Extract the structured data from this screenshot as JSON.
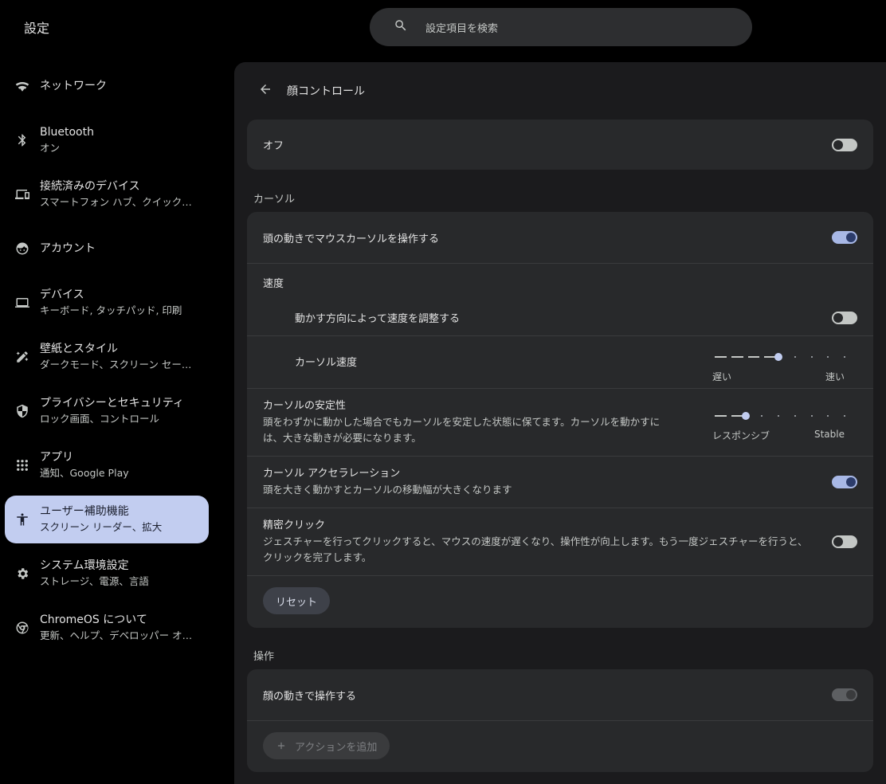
{
  "app": {
    "title": "設定"
  },
  "search": {
    "placeholder": "設定項目を検索"
  },
  "sidebar": {
    "items": [
      {
        "label": "ネットワーク",
        "sub": "",
        "icon": "wifi-icon"
      },
      {
        "label": "Bluetooth",
        "sub": "オン",
        "icon": "bluetooth-icon"
      },
      {
        "label": "接続済みのデバイス",
        "sub": "スマートフォン ハブ、クイック…",
        "icon": "connected-devices-icon"
      },
      {
        "label": "アカウント",
        "sub": "",
        "icon": "account-icon"
      },
      {
        "label": "デバイス",
        "sub": "キーボード, タッチパッド, 印刷",
        "icon": "laptop-icon"
      },
      {
        "label": "壁紙とスタイル",
        "sub": "ダークモード、スクリーン セー…",
        "icon": "palette-icon"
      },
      {
        "label": "プライバシーとセキュリティ",
        "sub": "ロック画面、コントロール",
        "icon": "shield-icon"
      },
      {
        "label": "アプリ",
        "sub": "通知、Google Play",
        "icon": "apps-grid-icon"
      },
      {
        "label": "ユーザー補助機能",
        "sub": "スクリーン リーダー、拡大",
        "icon": "accessibility-icon"
      },
      {
        "label": "システム環境設定",
        "sub": "ストレージ、電源、言語",
        "icon": "gear-icon"
      },
      {
        "label": "ChromeOS について",
        "sub": "更新、ヘルプ、デベロッパー オ…",
        "icon": "chrome-icon"
      }
    ],
    "active_index": 8,
    "active_color": "#c2cdf0"
  },
  "page": {
    "title": "顔コントロール"
  },
  "master": {
    "label": "オフ",
    "enabled": false
  },
  "cursor_section": {
    "title": "カーソル",
    "control_with_head": {
      "label": "頭の動きでマウスカーソルを操作する",
      "enabled": true
    },
    "speed": {
      "title": "速度",
      "adjust_by_direction": {
        "label": "動かす方向によって速度を調整する",
        "enabled": false
      },
      "cursor_speed": {
        "label": "カーソル速度",
        "min_label": "遅い",
        "max_label": "速い",
        "value": 5,
        "max": 9
      }
    },
    "stability": {
      "label": "カーソルの安定性",
      "description": "頭をわずかに動かした場合でもカーソルを安定した状態に保てます。カーソルを動かすには、大きな動きが必要になります。",
      "min_label": "レスポンシブ",
      "max_label": "Stable",
      "value": 3,
      "max": 9
    },
    "acceleration": {
      "label": "カーソル アクセラレーション",
      "description": "頭を大きく動かすとカーソルの移動幅が大きくなります",
      "enabled": true
    },
    "precision_click": {
      "label": "精密クリック",
      "description": "ジェスチャーを行ってクリックすると、マウスの速度が遅くなり、操作性が向上します。もう一度ジェスチャーを行うと、クリックを完了します。",
      "enabled": false
    },
    "reset_label": "リセット"
  },
  "actions_section": {
    "title": "操作",
    "control_with_face": {
      "label": "顔の動きで操作する",
      "enabled": true,
      "disabled": true
    },
    "add_action_label": "アクションを追加"
  }
}
